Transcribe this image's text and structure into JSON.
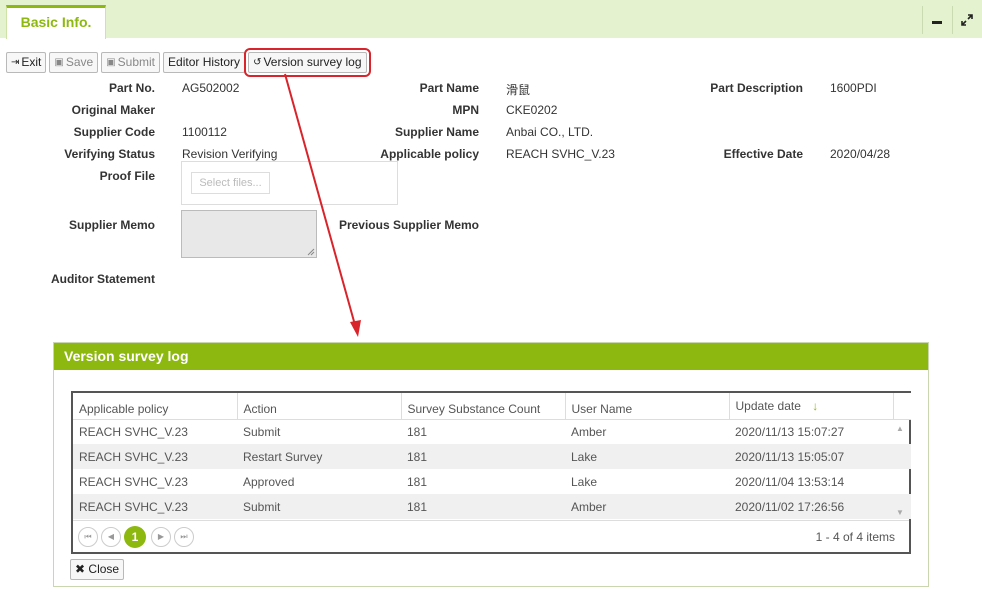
{
  "tab": {
    "label": "Basic Info."
  },
  "toolbar": {
    "exit": "Exit",
    "save": "Save",
    "submit": "Submit",
    "editor_history": "Editor History",
    "version_log": "Version survey log"
  },
  "form": {
    "part_no_label": "Part No.",
    "part_no": "AG502002",
    "part_name_label": "Part Name",
    "part_name": "滑鼠",
    "part_desc_label": "Part Description",
    "part_desc": "1600PDI",
    "orig_maker_label": "Original Maker",
    "mpn_label": "MPN",
    "mpn": "CKE0202",
    "supplier_code_label": "Supplier Code",
    "supplier_code": "1100112",
    "supplier_name_label": "Supplier Name",
    "supplier_name": "Anbai CO., LTD.",
    "verifying_status_label": "Verifying Status",
    "verifying_status": "Revision Verifying",
    "applicable_policy_label": "Applicable policy",
    "applicable_policy": "REACH SVHC_V.23",
    "effective_date_label": "Effective Date",
    "effective_date": "2020/04/28",
    "proof_file_label": "Proof File",
    "select_files": "Select files...",
    "supplier_memo_label": "Supplier Memo",
    "prev_supplier_memo_label": "Previous Supplier Memo",
    "auditor_statement_label": "Auditor Statement"
  },
  "dialog": {
    "title": "Version survey log",
    "columns": [
      "Applicable policy",
      "Action",
      "Survey Substance Count",
      "User Name",
      "Update date"
    ],
    "rows": [
      [
        "REACH SVHC_V.23",
        "Submit",
        "181",
        "Amber",
        "2020/11/13 15:07:27"
      ],
      [
        "REACH SVHC_V.23",
        "Restart Survey",
        "181",
        "Lake",
        "2020/11/13 15:05:07"
      ],
      [
        "REACH SVHC_V.23",
        "Approved",
        "181",
        "Lake",
        "2020/11/04 13:53:14"
      ],
      [
        "REACH SVHC_V.23",
        "Submit",
        "181",
        "Amber",
        "2020/11/02 17:26:56"
      ]
    ],
    "pager": {
      "current_page": "1",
      "info": "1 - 4 of 4 items"
    },
    "close": "Close"
  },
  "colors": {
    "accent": "#8cb80f",
    "highlight": "#d8242a"
  }
}
